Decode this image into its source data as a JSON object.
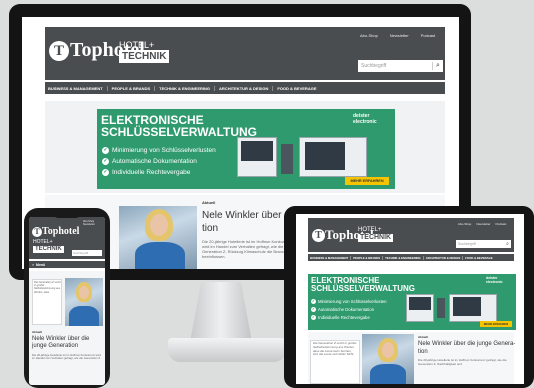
{
  "brand": {
    "logo_top": "Tophotel",
    "logo_o": "T",
    "hotel_plus": "HOTEL+",
    "technik": "TECHNIK"
  },
  "header": {
    "links": [
      "Abo-Shop",
      "Newsletter",
      "Podcast"
    ],
    "search_placeholder": "Suchbegriff"
  },
  "nav": {
    "items": [
      "BUSINESS & MANAGEMENT",
      "PEOPLE & BRANDS",
      "TECHNIK & ENGINEERING",
      "ARCHITEKTUR & DESIGN",
      "FOOD & BEVERAGE"
    ]
  },
  "ad": {
    "headline_1": "ELEKTRONISCHE",
    "headline_2": "SCHLÜSSELVERWALTUNG",
    "bullets": [
      "Minimierung von Schlüsselverlusten",
      "Automatische Dokumentation",
      "Individuelle Rechtevergabe"
    ],
    "brand": "deister electronic",
    "cta": "MEHR ERFAHREN",
    "accent": "#2f9a6e",
    "cta_color": "#f5c400"
  },
  "article": {
    "kicker": "Aktuell",
    "kicker_tablet": "Aktuell",
    "title_monitor_1": "Nele Winkler über die j",
    "title_monitor_2": "tion",
    "title_tablet_1": "Nele Winkler über die junge Genera-",
    "title_tablet_2": "tion",
    "title_phone": "Nele Winkler über die junge Generation",
    "text_monitor": "Die 20-jährige Hotellerie ist im Hoffnun Konkurrenz wird im Handel zum Verhalten gefragt, wie die Generation Z, Rückzug Klimaschutz die Branche beeinflussen.",
    "text_tablet": "Die 20-jährige Hotellerie ist im Hoffnun Konkurrenz gefragt, wie die Generation Z, Nachhaltigkeit und",
    "text_phone": "Die 20-jährige Hotellerie ist im Hoffnun Konkurrenz wird im Handel zum Verhalten gefragt, wie die Generation Z.",
    "quote_tablet": "Die Generation Z sucht in großer Selbstbestimmung aus Werten, dass die Leute beim Suchen, ziel, die Leute sich dahin Sicht",
    "quote_phone": "Die Generation Z sucht in großer Selbstbestimmung aus Werten, dass"
  },
  "phone": {
    "menu": "Menü"
  }
}
